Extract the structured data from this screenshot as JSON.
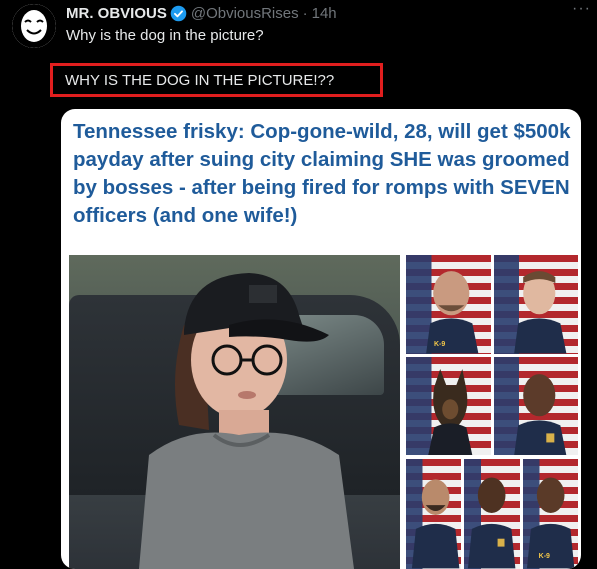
{
  "tweet": {
    "author_name": "MR. OBVIOUS",
    "handle": "@ObviousRises",
    "separator": "·",
    "time": "14h",
    "more": "···",
    "text": "Why is the dog in the picture?",
    "highlight_text": "WHY IS THE DOG IN THE PICTURE!??"
  },
  "card": {
    "headline": "Tennessee frisky: Cop-gone-wild, 28, will get $500k payday after suing city claiming SHE was groomed by bosses - after being fired for romps with SEVEN officers (and one wife!)",
    "patch_label": "K-9"
  },
  "colors": {
    "background": "#000000",
    "highlight_border": "#e11e1e",
    "verified": "#1d9bf0",
    "headline": "#1f5b9a",
    "muted": "#71767b"
  },
  "icons": [
    "avatar-mask-icon",
    "verified-badge-icon",
    "more-options-icon"
  ]
}
